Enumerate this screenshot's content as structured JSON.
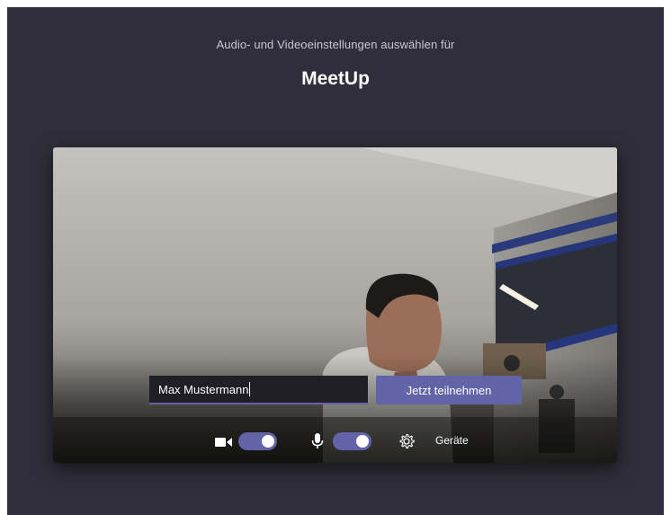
{
  "header": {
    "subtitle": "Audio- und Videoeinstellungen auswählen für",
    "meeting_title": "MeetUp"
  },
  "join_form": {
    "name_value": "Max Mustermann",
    "join_button_label": "Jetzt teilnehmen"
  },
  "controls": {
    "camera_toggle_on": true,
    "microphone_toggle_on": true,
    "devices_label": "Geräte"
  },
  "icons": {
    "camera": "video-camera-icon",
    "microphone": "microphone-icon",
    "devices": "gear-icon"
  },
  "colors": {
    "background": "#2f2e3a",
    "accent": "#6264a7",
    "text": "#ffffff"
  }
}
